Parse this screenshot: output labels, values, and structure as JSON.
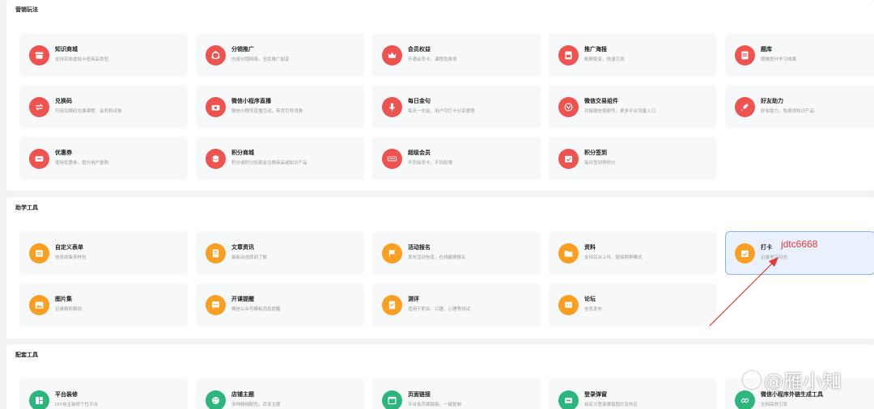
{
  "sections": {
    "marketing": {
      "title": "营销玩法",
      "cards": [
        {
          "title": "知识商城",
          "desc": "支持实体虚拟卡密商品类型",
          "icon": "shop-icon"
        },
        {
          "title": "分销推广",
          "desc": "内容分销网络，全民推广裂变",
          "icon": "share-icon"
        },
        {
          "title": "会员权益",
          "desc": "开通会员卡，课程免费领",
          "icon": "crown-icon"
        },
        {
          "title": "推广海报",
          "desc": "刷屏裂变，快速引流",
          "icon": "poster-icon"
        },
        {
          "title": "题库",
          "desc": "题做提升学习效果",
          "icon": "question-bank-icon"
        },
        {
          "title": "兑换码",
          "desc": "可用兑换码兑换课程、会员和试卷",
          "icon": "exchange-icon"
        },
        {
          "title": "微信小程序直播",
          "desc": "微信小程序直播互动，带货引导消费",
          "icon": "camera-icon"
        },
        {
          "title": "每日金句",
          "desc": "每天一句话，用户可打卡分享感悟",
          "icon": "microphone-icon"
        },
        {
          "title": "微信交易组件",
          "desc": "对接微信视频号，更多平台流量入口",
          "icon": "video-channel-icon"
        },
        {
          "title": "好友助力",
          "desc": "好友助力，免费领知识产品",
          "icon": "rocket-icon"
        },
        {
          "title": "优惠券",
          "desc": "使用优惠券，提升用户复购",
          "icon": "coupon-icon"
        },
        {
          "title": "积分商城",
          "desc": "积分或积分加现金兑换商品或知识产品",
          "icon": "coins-icon"
        },
        {
          "title": "超级会员",
          "desc": "不同会员卡，不同权限",
          "icon": "svip-icon"
        },
        {
          "title": "积分签到",
          "desc": "每日签到得积分",
          "icon": "calendar-check-icon"
        }
      ]
    },
    "learning": {
      "title": "助学工具",
      "cards": [
        {
          "title": "自定义表单",
          "desc": "信息收集多样化",
          "icon": "form-icon"
        },
        {
          "title": "文章资讯",
          "desc": "最新动态即刻了解",
          "icon": "article-icon"
        },
        {
          "title": "活动报名",
          "desc": "发布活动信息，在线缴费报名",
          "icon": "flag-icon"
        },
        {
          "title": "资料",
          "desc": "支持后台上传、链接两种模式",
          "icon": "folder-icon"
        },
        {
          "title": "打卡",
          "desc": "记录学习日志",
          "icon": "checkin-icon"
        },
        {
          "title": "图片集",
          "desc": "记录精彩瞬间",
          "icon": "image-icon"
        },
        {
          "title": "开课提醒",
          "desc": "微信公众号模板消息提醒",
          "icon": "chat-bubble-icon"
        },
        {
          "title": "测评",
          "desc": "适用于职业、兴趣、心理等测试",
          "icon": "evaluation-icon"
        },
        {
          "title": "论坛",
          "desc": "信息发布",
          "icon": "forum-icon"
        }
      ]
    },
    "support": {
      "title": "配套工具",
      "cards": [
        {
          "title": "平台装修",
          "desc": "DIY自主装修个性平台",
          "icon": "layout-icon"
        },
        {
          "title": "店铺主题",
          "desc": "多种精细配色，百变主题",
          "icon": "palette-icon"
        },
        {
          "title": "页面链接",
          "desc": "平台各页面链接，一键复制",
          "icon": "browser-icon"
        },
        {
          "title": "登录弹窗",
          "desc": "自定义登录弹窗图片及热区",
          "icon": "login-popup-icon"
        },
        {
          "title": "微信小程序外链生成工具",
          "desc": "全网高效引流",
          "icon": "link-icon"
        }
      ]
    }
  },
  "annotation": {
    "text": "jdtc6668"
  },
  "watermark": {
    "text": "@雁小知"
  },
  "colors": {
    "red": "#ef5350",
    "orange": "#fa9f22",
    "green": "#2cb67d",
    "active_border": "#8fb4e8",
    "annotation": "#e53935"
  }
}
